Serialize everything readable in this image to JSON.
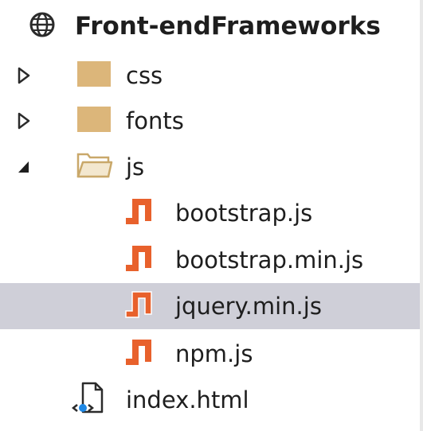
{
  "tree": {
    "project": {
      "label": "Front-endFrameworks",
      "icon": "globe-icon"
    },
    "items": [
      {
        "label": "css",
        "type": "folder",
        "state": "collapsed",
        "icon": "folder-icon"
      },
      {
        "label": "fonts",
        "type": "folder",
        "state": "collapsed",
        "icon": "folder-icon"
      },
      {
        "label": "js",
        "type": "folder",
        "state": "expanded",
        "icon": "folder-open-icon"
      },
      {
        "label": "bootstrap.js",
        "type": "file",
        "icon": "js-file-icon"
      },
      {
        "label": "bootstrap.min.js",
        "type": "file",
        "icon": "js-file-icon"
      },
      {
        "label": "jquery.min.js",
        "type": "file",
        "icon": "js-file-icon",
        "selected": true
      },
      {
        "label": "npm.js",
        "type": "file",
        "icon": "js-file-icon"
      },
      {
        "label": "index.html",
        "type": "file",
        "icon": "html-file-icon"
      }
    ]
  },
  "colors": {
    "folder": "#dcb67a",
    "js_icon": "#e8612c",
    "selection": "#cfcfd8",
    "html_badge": "#1e88e5"
  }
}
